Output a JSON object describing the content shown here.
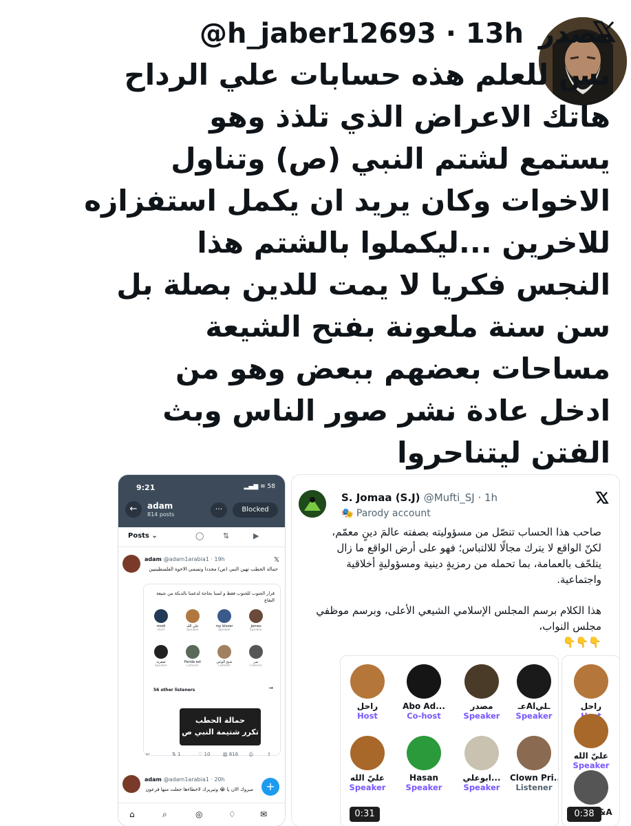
{
  "tweet": {
    "display_name": "مصدر",
    "handle_time": "@h_jaber12693 · 13h",
    "body_lines": [
      "بس للعلم هذه حسابات علي الرداح",
      "هاتك الاعراض  الذي تلذذ وهو",
      "يستمع لشتم النبي (ص) وتناول",
      "الاخوات وكان يريد ان يكمل استفزازه",
      "للاخرين ...ليكملوا بالشتم هذا",
      "النجس فكريا لا يمت للدين بصلة بل",
      "سن سنة ملعونة بفتح الشيعة",
      "مساحات بعضهم ببعض وهو من",
      "ادخل عادة نشر صور الناس وبث",
      "الفتن ليتناحروا"
    ],
    "icons": {
      "logo": "x-logo-icon",
      "avatar": "bearded-man-avatar"
    }
  },
  "left_shot": {
    "time": "9:21",
    "status": "▂▄▆ ≋ 58",
    "back": "←",
    "profile_name": "adam",
    "profile_posts": "814 posts",
    "more": "···",
    "blocked": "Blocked",
    "tab_posts": "Posts ⌄",
    "post": {
      "author": "adam",
      "meta": "@adam1arabia1 · 19h",
      "text": "حمالة الحطب تهين النبي (ص)  مجددا وتسمي الاخوة الفلسطينيين",
      "card_text": "قرار الجنوب للجنوب فقط  و لسنا بحاجة لدعمنا بالدبكة من شيعة البقاع",
      "speakers_row1": [
        {
          "name": "modi",
          "role": "Host"
        },
        {
          "name": "علي الله",
          "role": "Speaker"
        },
        {
          "name": "roy blozer",
          "role": "Speaker"
        },
        {
          "name": "James",
          "role": "Speaker"
        }
      ],
      "speakers_row2": [
        {
          "name": "صقرية",
          "role": "Speaker"
        },
        {
          "name": "Panda est",
          "role": "Listener"
        },
        {
          "name": "شيخ الوعي",
          "role": "Listener"
        },
        {
          "name": "نمر",
          "role": "Listener"
        }
      ],
      "listeners": "56 other listeners",
      "overlay_line1": "حمالة الحطب",
      "overlay_line2": "تكرر شتيمة النبي ص",
      "actions": [
        "↩",
        "⇅ 1",
        "♡ 10",
        "▥ 616",
        "⎙",
        "⇪"
      ]
    },
    "post2": {
      "author": "adam",
      "meta": "@adam1arabia1 · 20h",
      "text": "مبروك الان يا 😭 وتبريرك لاخطاءها جعلت منها فرعون"
    },
    "fab": "+"
  },
  "right_shot": {
    "author": "S. Jomaa (S.J)",
    "meta": "@Mufti_SJ · 1h",
    "parody": "🎭 Parody account",
    "para1": "صاحب هذا الحساب تنصّل من مسؤوليته بصفته عالمَ دينٍ معمّم، لكنّ الواقع لا يترك مجالًا للالتباس؛ فهو على أرض الواقع ما زال يتلحّف بالعمامة، بما تحمله من رمزيةٍ دينية ومسؤوليةٍ أخلاقية واجتماعية.",
    "para2": "هذا الكلام برسم المجلس الإسلامي الشيعي الأعلى، وبرسم موظفي مجلس النواب،",
    "pointers": "👇👇👇",
    "card1_row1": [
      {
        "name": "عـAlـلي",
        "role": "Speaker"
      },
      {
        "name": "مصدر",
        "role": "Speaker"
      },
      {
        "name": "Abo Ad...",
        "role": "Co-host"
      },
      {
        "name": "راحل",
        "role": "Host"
      }
    ],
    "card1_row2": [
      {
        "name": "Clown Pri...",
        "role": "Listener"
      },
      {
        "name": "ابوعلي...",
        "role": "Speaker"
      },
      {
        "name": "Hasan",
        "role": "Speaker"
      },
      {
        "name": "عليّ الله",
        "role": "Speaker"
      }
    ],
    "card2": [
      {
        "name": "راحل",
        "role": "Host"
      },
      {
        "name": "عليّ الله",
        "role": "Speaker"
      },
      {
        "name": "HDR T&A",
        "role": ""
      }
    ],
    "duration1": "0:31",
    "duration2": "0:38"
  }
}
